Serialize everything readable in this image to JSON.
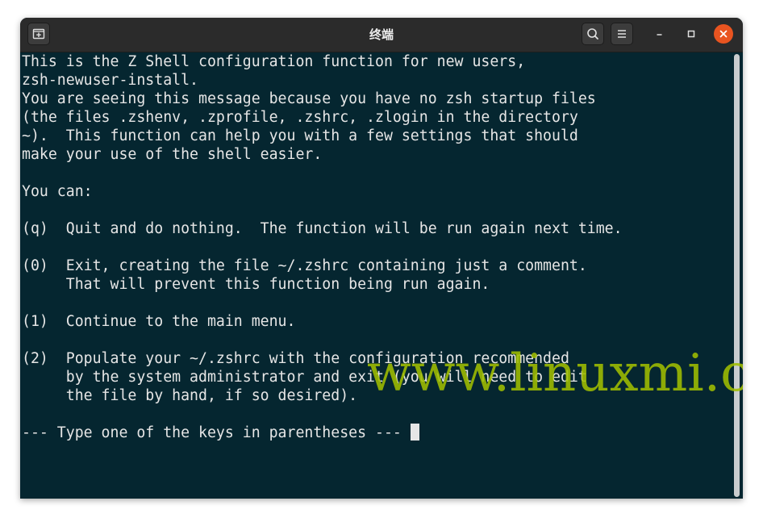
{
  "window": {
    "title": "终端"
  },
  "terminal": {
    "lines": [
      "This is the Z Shell configuration function for new users,",
      "zsh-newuser-install.",
      "You are seeing this message because you have no zsh startup files",
      "(the files .zshenv, .zprofile, .zshrc, .zlogin in the directory",
      "~).  This function can help you with a few settings that should",
      "make your use of the shell easier.",
      "",
      "You can:",
      "",
      "(q)  Quit and do nothing.  The function will be run again next time.",
      "",
      "(0)  Exit, creating the file ~/.zshrc containing just a comment.",
      "     That will prevent this function being run again.",
      "",
      "(1)  Continue to the main menu.",
      "",
      "(2)  Populate your ~/.zshrc with the configuration recommended",
      "     by the system administrator and exit (you will need to edit",
      "     the file by hand, if so desired).",
      "",
      "--- Type one of the keys in parentheses --- "
    ]
  },
  "watermark": {
    "text": "www.linuxmi.com",
    "color": "#a0be00"
  },
  "colors": {
    "terminal_bg": "#052630",
    "titlebar_bg": "#2b2b2b",
    "close_button": "#e95420",
    "text": "#e6e6e6"
  },
  "icons": {
    "new_tab": "new-tab-icon",
    "search": "search-icon",
    "menu": "hamburger-menu-icon",
    "minimize": "minimize-icon",
    "maximize": "maximize-icon",
    "close": "close-icon"
  }
}
